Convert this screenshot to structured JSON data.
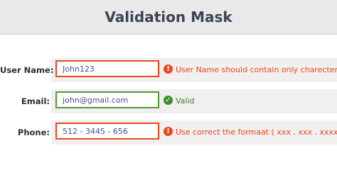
{
  "title": "Validation Mask",
  "fields": [
    {
      "label": "User Name:",
      "value": "John123",
      "status": "invalid",
      "icon": "exclamation-icon",
      "message": "User Name should contain only charecters"
    },
    {
      "label": "Email:",
      "value": "john@gmail.com",
      "status": "valid",
      "icon": "check-icon",
      "message": "Valid"
    },
    {
      "label": "Phone:",
      "value": "512 - 3445 - 656",
      "status": "invalid",
      "icon": "exclamation-icon",
      "message": "Use correct the formaat   ( xxx . xxx . xxxx )"
    }
  ],
  "colors": {
    "error": "#e8491d",
    "valid": "#4d9a34",
    "header_bg": "#e9e9ea",
    "row_bg": "#f1efef"
  }
}
